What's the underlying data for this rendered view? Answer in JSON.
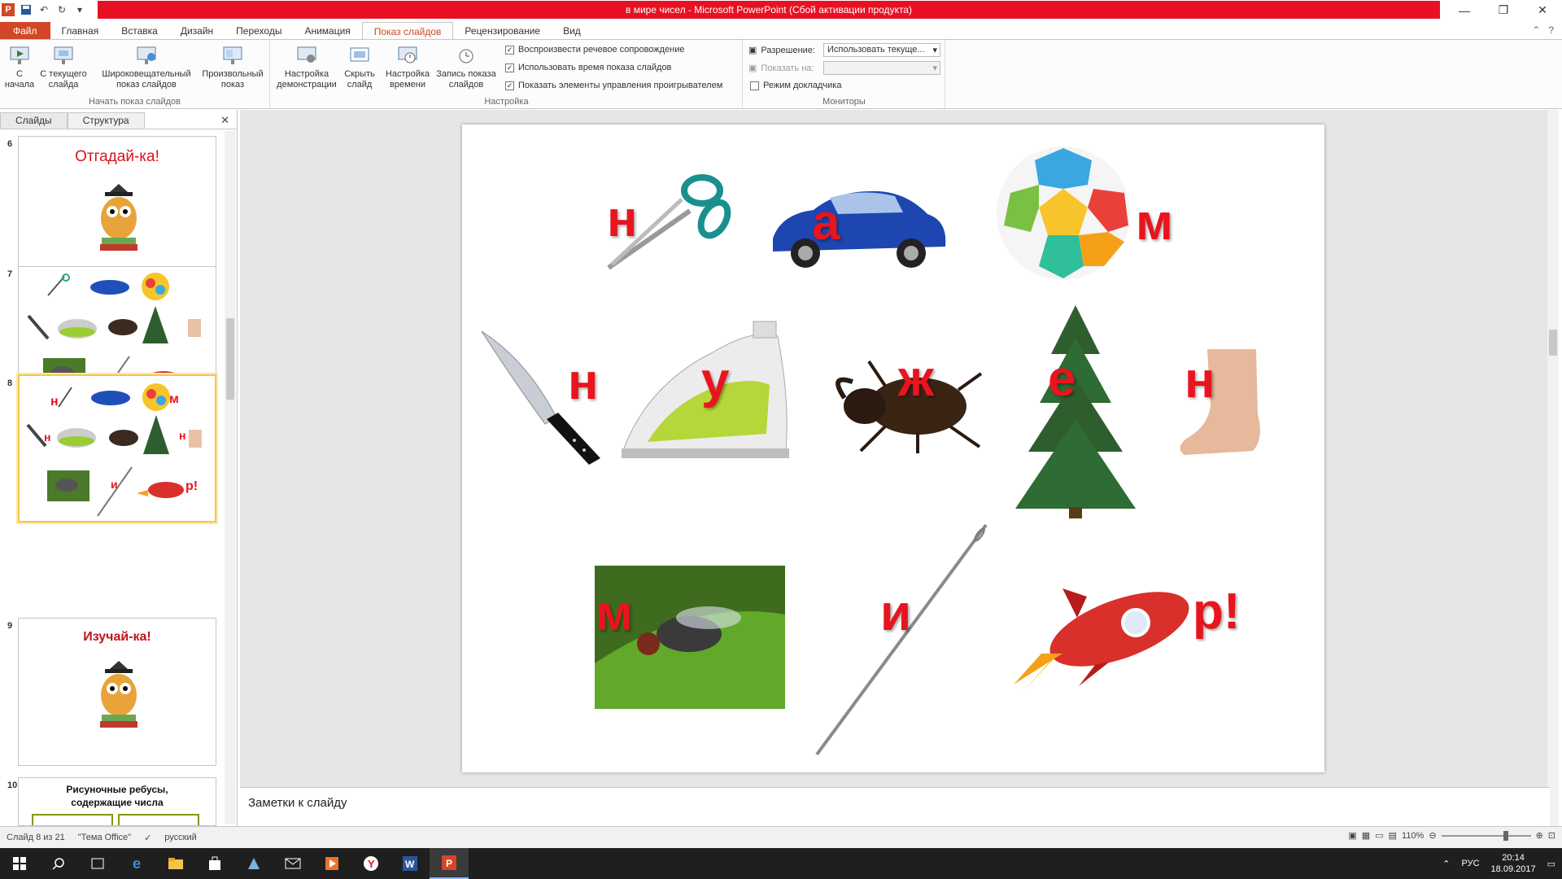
{
  "window": {
    "title": "в мире чисел  -  Microsoft PowerPoint (Сбой активации продукта)"
  },
  "tabs": [
    {
      "label": "Файл",
      "kind": "file"
    },
    {
      "label": "Главная"
    },
    {
      "label": "Вставка"
    },
    {
      "label": "Дизайн"
    },
    {
      "label": "Переходы"
    },
    {
      "label": "Анимация"
    },
    {
      "label": "Показ слайдов",
      "active": true
    },
    {
      "label": "Рецензирование"
    },
    {
      "label": "Вид"
    }
  ],
  "ribbon": {
    "group_start": {
      "label": "Начать показ слайдов",
      "from_start": "С\nначала",
      "from_current": "С текущего\nслайда",
      "broadcast": "Широковещательный\nпоказ слайдов",
      "custom": "Произвольный\nпоказ"
    },
    "group_setup": {
      "label": "Настройка",
      "setup_show": "Настройка\nдемонстрации",
      "hide_slide": "Скрыть\nслайд",
      "rehearse": "Настройка\nвремени",
      "record": "Запись показа\nслайдов",
      "chk_narration": "Воспроизвести речевое сопровождение",
      "chk_timings": "Использовать время показа слайдов",
      "chk_controls": "Показать элементы управления проигрывателем"
    },
    "group_monitors": {
      "label": "Мониторы",
      "resolution_label": "Разрешение:",
      "resolution_value": "Использовать текуще...",
      "show_on_label": "Показать на:",
      "presenter_view": "Режим докладчика"
    }
  },
  "left_panel": {
    "tab_slides": "Слайды",
    "tab_outline": "Структура",
    "thumbs": [
      {
        "num": "6",
        "title": "Отгадай-ка!"
      },
      {
        "num": "7"
      },
      {
        "num": "8"
      },
      {
        "num": "9",
        "title": "Изучай-ка!"
      },
      {
        "num": "10",
        "title": "Рисуночные  ребусы,\nсодержащие числа"
      }
    ]
  },
  "slide": {
    "letters": {
      "n1": "н",
      "a": "а",
      "m1": "м",
      "n2": "н",
      "u": "у",
      "zh": "ж",
      "e": "е",
      "n3": "н",
      "m2": "м",
      "i": "и",
      "r": "р!"
    }
  },
  "notes": {
    "placeholder": "Заметки к слайду"
  },
  "status": {
    "slide_info": "Слайд 8 из 21",
    "theme": "\"Тема Office\"",
    "language": "русский",
    "zoom": "110%"
  },
  "taskbar": {
    "lang": "РУС",
    "time": "20:14",
    "date": "18.09.2017"
  },
  "colors": {
    "accent": "#d24726",
    "title_red": "#e81123",
    "letter_red": "#e8141e"
  }
}
